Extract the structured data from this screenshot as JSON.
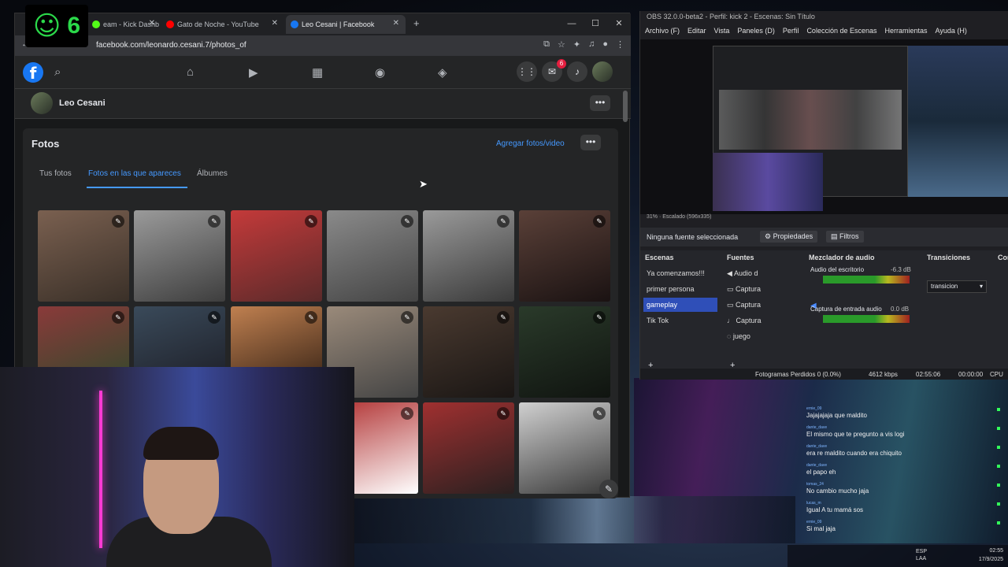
{
  "browser": {
    "tabs": [
      {
        "label": "eam - Kick Dashb",
        "color": "#53fc18"
      },
      {
        "label": "Gato de Noche - YouTube",
        "color": "#ff0000"
      },
      {
        "label": "Leo Cesani | Facebook",
        "color": "#1877f2"
      }
    ],
    "url": "facebook.com/leonardo.cesani.7/photos_of"
  },
  "facebook": {
    "logo": "f",
    "notification_count": "6",
    "profile_name": "Leo Cesani",
    "photos_title": "Fotos",
    "add_photos": "Agregar fotos/video",
    "tabs": [
      "Tus fotos",
      "Fotos en las que apareces",
      "Álbumes"
    ],
    "photo_colors": [
      [
        "#7a6050",
        "#3a3028"
      ],
      [
        "#9a9a9a",
        "#3e3e3e"
      ],
      [
        "#c43a3a",
        "#5a2a2a"
      ],
      [
        "#8a8a8a",
        "#444444"
      ],
      [
        "#9a9a9a",
        "#3a3a3a"
      ],
      [
        "#5a4038",
        "#1a1212"
      ],
      [
        "#8a3a3a",
        "#2a4a2a"
      ],
      [
        "#3a4a5a",
        "#1a1a22"
      ],
      [
        "#c08050",
        "#2a1a10"
      ],
      [
        "#9a8a7a",
        "#444444"
      ],
      [
        "#4a3a30",
        "#1a1614"
      ],
      [
        "#2a3a2a",
        "#101410"
      ],
      [
        "#b03030",
        "#ffffff"
      ],
      [
        "#a03030",
        "#2a2020"
      ],
      [
        "#d0d0d0",
        "#3a3a3a"
      ]
    ]
  },
  "counter": {
    "icon": "person-icon",
    "value": "6"
  },
  "obs": {
    "title": "OBS 32.0.0-beta2 - Perfil: kick 2 - Escenas: Sin Título",
    "menu": [
      "Archivo (F)",
      "Editar",
      "Vista",
      "Paneles (D)",
      "Perfil",
      "Colección de Escenas",
      "Herramientas",
      "Ayuda (H)"
    ],
    "zoom": "31%",
    "scale": "Escalado (596x335)",
    "no_source": "Ninguna fuente seleccionada",
    "properties": "Propiedades",
    "filters": "Filtros",
    "panels": {
      "scenes": "Escenas",
      "sources": "Fuentes",
      "mixer": "Mezclador de audio",
      "transitions": "Transiciones",
      "transitions_short": "Con"
    },
    "scenes": [
      "Ya comenzamos!!!",
      "primer persona",
      "gameplay",
      "Tik Tok"
    ],
    "sources": [
      "Audio d",
      "Captura",
      "Captura",
      "Captura",
      "juego"
    ],
    "mixer": [
      {
        "name": "Audio del escritorio",
        "db": "-6.3 dB"
      },
      {
        "name": "Captura de entrada audio",
        "db": "0.0 dB"
      }
    ],
    "transition_value": "transicion",
    "status": {
      "dropped": "Fotogramas Perdidos 0 (0.0%)",
      "bitrate": "4612 kbps",
      "time1": "02:55:06",
      "time2": "00:00:00",
      "cpu": "CPU"
    }
  },
  "chat": [
    {
      "user": "ernie_09",
      "msg": "Jajajajaja que maldito"
    },
    {
      "user": "dante_dave",
      "msg": "El mismo que te pregunto a vis logi"
    },
    {
      "user": "dante_dave",
      "msg": "era re maldito cuando era chiquito"
    },
    {
      "user": "dante_dave",
      "msg": "el papo eh"
    },
    {
      "user": "tomas_24",
      "msg": "No cambio mucho jaja"
    },
    {
      "user": "lucas_m",
      "msg": "Igual A tu mamá sos"
    },
    {
      "user": "ernie_09",
      "msg": "Si mal jaja"
    }
  ],
  "taskbar": {
    "lang1": "ESP",
    "lang2": "LAA",
    "time": "02:55",
    "date": "17/9/2025"
  }
}
